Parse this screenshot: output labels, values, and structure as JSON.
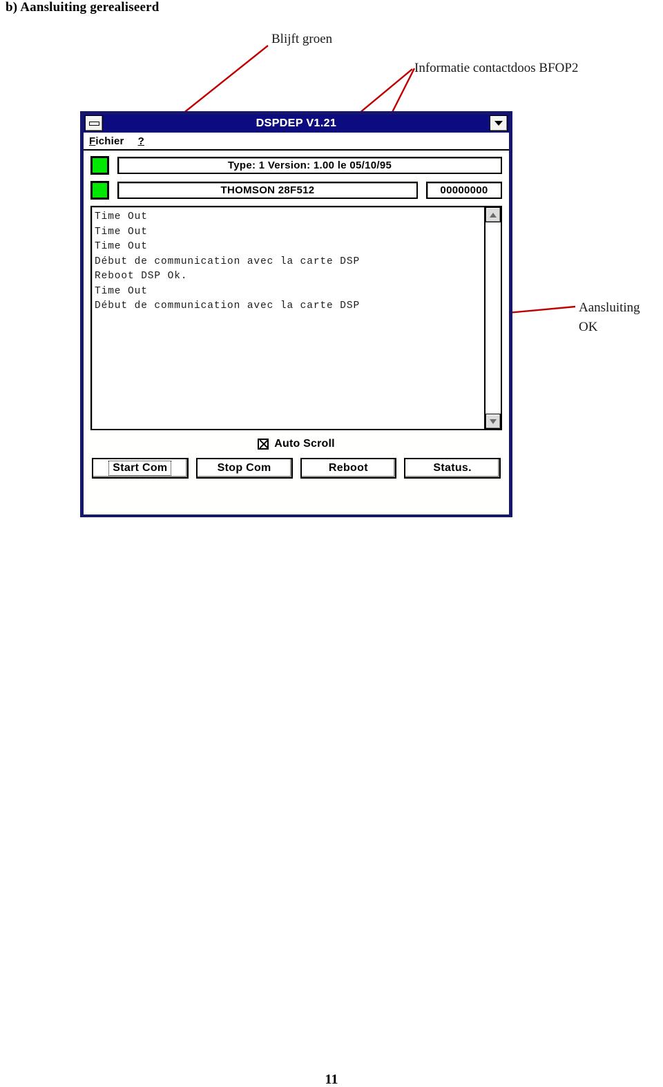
{
  "page": {
    "heading": "b) Aansluiting gerealiseerd",
    "page_number": "11"
  },
  "annotations": {
    "blijft_groen": "Blijft groen",
    "informatie": "Informatie contactdoos BFOP2",
    "aansluiting_ok": "Aansluiting OK",
    "arrow_color": "#c00000"
  },
  "window": {
    "title": "DSPDEP V1.21",
    "titlebar_color": "#0c0c80",
    "border_color": "#16166e",
    "minimize_icon": "minimize-icon",
    "maximize_icon": "maximize-icon",
    "menu": [
      {
        "label_prefix": "F",
        "label_rest": "ichier",
        "name": "menu-fichier"
      },
      {
        "label_prefix": "?",
        "label_rest": "",
        "name": "menu-help"
      }
    ],
    "status": {
      "led1_color": "#00e800",
      "led2_color": "#00e800",
      "version_field": "Type: 1 Version:  1.00 le 05/10/95",
      "device_field": "THOMSON 28F512",
      "counter_field": "00000000"
    },
    "log": {
      "lines": [
        "Time Out",
        "Time Out",
        "Time Out",
        "Début de communication avec la carte DSP",
        "Reboot DSP Ok.",
        "Time Out",
        "Début de communication avec la carte DSP"
      ]
    },
    "scrollbar": {
      "up_icon": "scroll-up-icon",
      "down_icon": "scroll-down-icon"
    },
    "auto_scroll": {
      "label": "Auto Scroll",
      "checked": true
    },
    "buttons": [
      {
        "label": "Start Com",
        "focused": true
      },
      {
        "label": "Stop Com",
        "focused": false
      },
      {
        "label": "Reboot",
        "focused": false
      },
      {
        "label": "Status.",
        "focused": false
      }
    ]
  }
}
